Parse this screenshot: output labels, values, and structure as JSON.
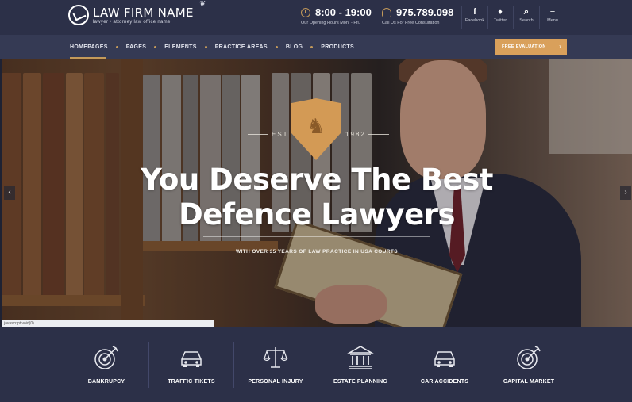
{
  "header": {
    "logo_name": "LAW FIRM NAME",
    "logo_tagline": "lawyer • attorney law office name",
    "hours": {
      "value": "8:00 - 19:00",
      "caption": "Our Opening Hours Mon. - Fri."
    },
    "phone": {
      "value": "975.789.098",
      "caption": "Call Us For Free Consultation"
    },
    "social": [
      {
        "glyph": "f",
        "label": "Facebook",
        "icon": "facebook-icon"
      },
      {
        "glyph": "🐦",
        "label": "Twitter",
        "icon": "twitter-icon"
      },
      {
        "glyph": "⌕",
        "label": "Search",
        "icon": "search-icon"
      },
      {
        "glyph": "≡",
        "label": "Menu",
        "icon": "menu-icon"
      }
    ]
  },
  "nav": {
    "items": [
      "HOMEPAGES",
      "PAGES",
      "ELEMENTS",
      "PRACTICE AREAS",
      "BLOG",
      "PRODUCTS"
    ],
    "cta_label": "FREE EVALUATION",
    "cta_arrow": "›"
  },
  "hero": {
    "est_left": "EST.",
    "est_right": "1982",
    "title_line1": "You Deserve The Best",
    "title_line2": "Defence Lawyers",
    "subtitle": "WITH OVER 35 YEARS OF LAW PRACTICE IN USA COURTS",
    "prev_arrow": "‹",
    "next_arrow": "›",
    "status_text": "javascript:void(0)"
  },
  "services": [
    {
      "label": "BANKRUPCY",
      "icon": "target-icon"
    },
    {
      "label": "TRAFFIC TIKETS",
      "icon": "car-icon"
    },
    {
      "label": "PERSONAL INJURY",
      "icon": "scales-icon"
    },
    {
      "label": "ESTATE PLANNING",
      "icon": "courthouse-icon"
    },
    {
      "label": "CAR ACCIDENTS",
      "icon": "car-icon"
    },
    {
      "label": "CAPITAL MARKET",
      "icon": "target-icon"
    }
  ],
  "colors": {
    "header_bg": "#2c3048",
    "nav_bg": "#353a54",
    "accent_gold": "#d9a05b"
  }
}
